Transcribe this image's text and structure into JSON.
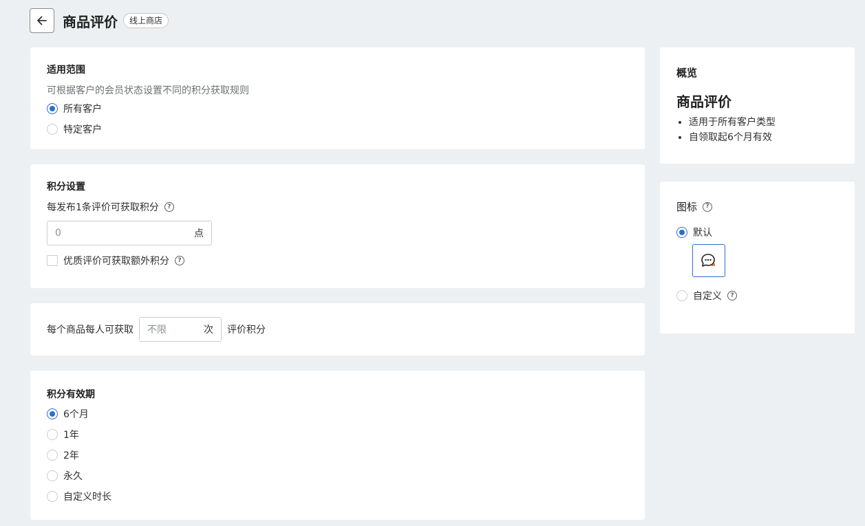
{
  "header": {
    "title": "商品评价",
    "badge": "线上商店"
  },
  "scope": {
    "title": "适用范围",
    "subtitle": "可根据客户的会员状态设置不同的积分获取规则",
    "options": [
      {
        "label": "所有客户",
        "checked": true
      },
      {
        "label": "特定客户",
        "checked": false
      }
    ]
  },
  "points": {
    "title": "积分设置",
    "field_label": "每发布1条评价可获取积分",
    "placeholder": "0",
    "suffix": "点",
    "extra_checkbox_label": "优质评价可获取额外积分"
  },
  "limit": {
    "prefix": "每个商品每人可获取",
    "placeholder": "不限",
    "suffix": "次",
    "postfix": "评价积分"
  },
  "validity": {
    "title": "积分有效期",
    "options": [
      {
        "label": "6个月",
        "checked": true
      },
      {
        "label": "1年",
        "checked": false
      },
      {
        "label": "2年",
        "checked": false
      },
      {
        "label": "永久",
        "checked": false
      },
      {
        "label": "自定义时长",
        "checked": false
      }
    ]
  },
  "overview": {
    "title": "概览",
    "name": "商品评价",
    "items": [
      "适用于所有客户类型",
      "自领取起6个月有效"
    ]
  },
  "icon_settings": {
    "title": "图标",
    "default_label": "默认",
    "custom_label": "自定义",
    "default_icon": "chat-bubble-icon",
    "accent_color": "#f0812e"
  },
  "colors": {
    "primary": "#2c6ecb",
    "background": "#ecf0f3"
  }
}
